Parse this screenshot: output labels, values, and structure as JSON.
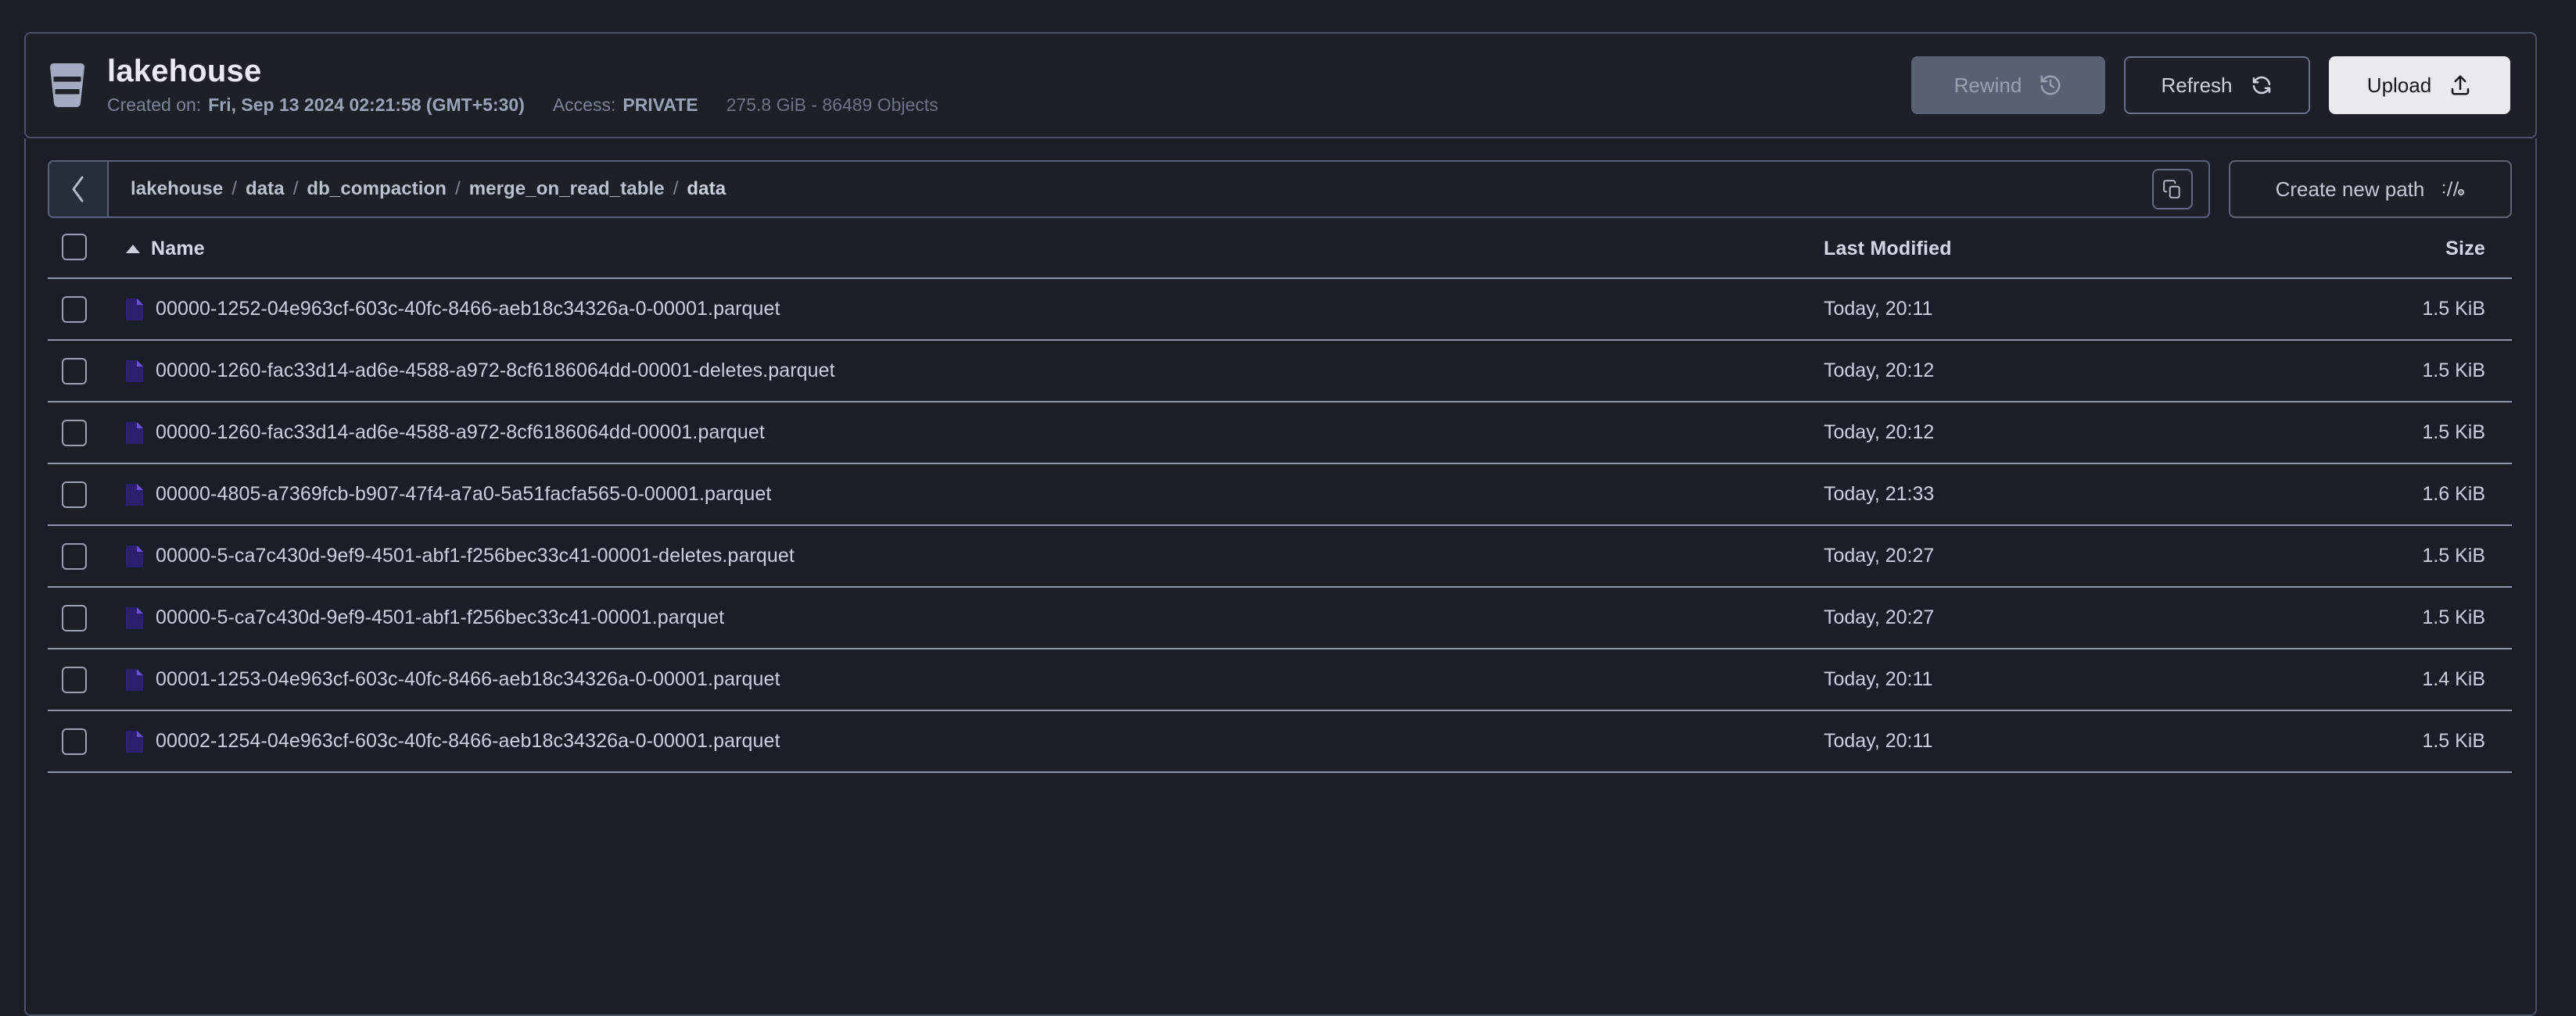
{
  "bucket": {
    "icon": "bucket-icon",
    "name": "lakehouse",
    "created_label": "Created on:",
    "created_value": "Fri, Sep 13 2024 02:21:58 (GMT+5:30)",
    "access_label": "Access:",
    "access_value": "PRIVATE",
    "stats": "275.8 GiB - 86489 Objects"
  },
  "header_actions": {
    "rewind_label": "Rewind",
    "rewind_icon": "rewind-clock-icon",
    "refresh_label": "Refresh",
    "refresh_icon": "refresh-icon",
    "upload_label": "Upload",
    "upload_icon": "upload-icon"
  },
  "path_bar": {
    "back_icon": "chevron-left-icon",
    "copy_icon": "copy-icon",
    "separator": "/",
    "crumbs": [
      "lakehouse",
      "data",
      "db_compaction",
      "merge_on_read_table",
      "data"
    ],
    "create_path_label": "Create new path",
    "create_path_icon": "path-slash-icon"
  },
  "table": {
    "select_all_checkbox": false,
    "sort_column": "Name",
    "sort_direction": "asc",
    "columns": {
      "name": "Name",
      "last_modified": "Last Modified",
      "size": "Size"
    },
    "rows": [
      {
        "checked": false,
        "icon": "parquet-file-icon",
        "name": "00000-1252-04e963cf-603c-40fc-8466-aeb18c34326a-0-00001.parquet",
        "last_modified": "Today, 20:11",
        "size": "1.5 KiB"
      },
      {
        "checked": false,
        "icon": "parquet-file-icon",
        "name": "00000-1260-fac33d14-ad6e-4588-a972-8cf6186064dd-00001-deletes.parquet",
        "last_modified": "Today, 20:12",
        "size": "1.5 KiB"
      },
      {
        "checked": false,
        "icon": "parquet-file-icon",
        "name": "00000-1260-fac33d14-ad6e-4588-a972-8cf6186064dd-00001.parquet",
        "last_modified": "Today, 20:12",
        "size": "1.5 KiB"
      },
      {
        "checked": false,
        "icon": "parquet-file-icon",
        "name": "00000-4805-a7369fcb-b907-47f4-a7a0-5a51facfa565-0-00001.parquet",
        "last_modified": "Today, 21:33",
        "size": "1.6 KiB"
      },
      {
        "checked": false,
        "icon": "parquet-file-icon",
        "name": "00000-5-ca7c430d-9ef9-4501-abf1-f256bec33c41-00001-deletes.parquet",
        "last_modified": "Today, 20:27",
        "size": "1.5 KiB"
      },
      {
        "checked": false,
        "icon": "parquet-file-icon",
        "name": "00000-5-ca7c430d-9ef9-4501-abf1-f256bec33c41-00001.parquet",
        "last_modified": "Today, 20:27",
        "size": "1.5 KiB"
      },
      {
        "checked": false,
        "icon": "parquet-file-icon",
        "name": "00001-1253-04e963cf-603c-40fc-8466-aeb18c34326a-0-00001.parquet",
        "last_modified": "Today, 20:11",
        "size": "1.4 KiB"
      },
      {
        "checked": false,
        "icon": "parquet-file-icon",
        "name": "00002-1254-04e963cf-603c-40fc-8466-aeb18c34326a-0-00001.parquet",
        "last_modified": "Today, 20:11",
        "size": "1.5 KiB"
      }
    ]
  },
  "colors": {
    "page_background": "#1a1e28",
    "panel_border": "#4a5268",
    "text_primary": "#c9d0dc",
    "text_muted": "#7b8496",
    "file_icon": "#2b1f6e",
    "file_icon_fold": "#6b4fd6",
    "upload_button": "#e8ebed",
    "rewind_disabled": "#5a6175"
  }
}
